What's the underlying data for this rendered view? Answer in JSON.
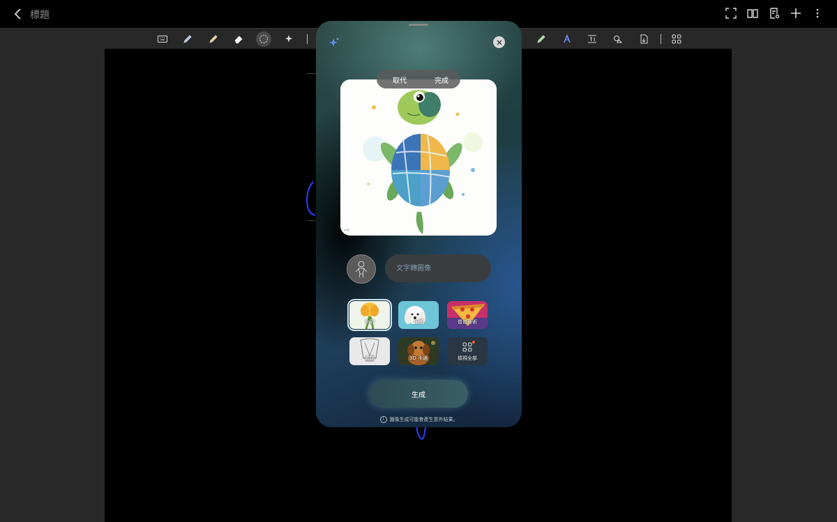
{
  "header": {
    "title": "標題"
  },
  "panel": {
    "tabs": {
      "replace": "取代",
      "done": "完成"
    },
    "prompt_placeholder": "文字轉圖像",
    "styles": [
      {
        "label": "水彩"
      },
      {
        "label": "插圖"
      },
      {
        "label": "普普藝術"
      },
      {
        "label": "素描"
      },
      {
        "label": "3D 卡通"
      },
      {
        "label": "檢視全部"
      }
    ],
    "generate_label": "生成",
    "disclaimer": "圖像生成可能會產生意外結果。"
  },
  "colors": {
    "accent_blue": "#3b5bd6",
    "panel_teal": "#2f4a48",
    "toolbar_bg": "#282828"
  }
}
